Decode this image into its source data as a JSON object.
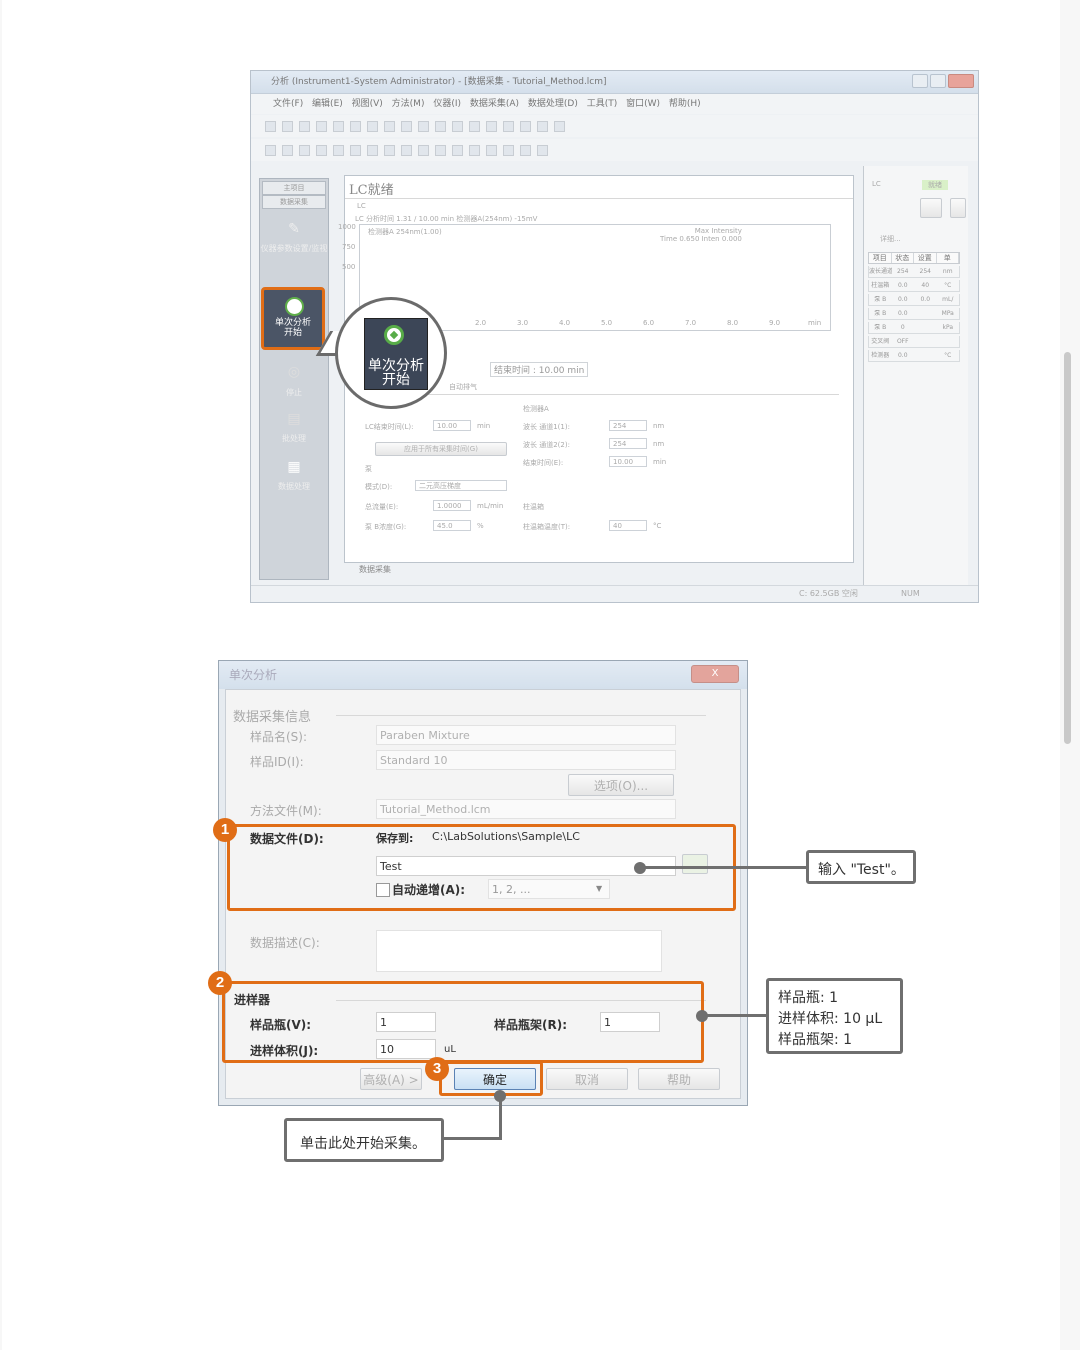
{
  "screenshot1": {
    "window_title": "分析 (Instrument1-System Administrator) - [数据采集 - Tutorial_Method.lcm]",
    "menu": "文件(F)  编辑(E)  视图(V)  方法(M)  仪器(I)  数据采集(A)  数据处理(D)  工具(T)  窗口(W)  帮助(H)",
    "left_panel": {
      "header": "主项目",
      "tab": "数据采集",
      "item_settings": "仪器参数设置/监视",
      "highlight_button": "单次分析\n开始",
      "item_stop": "停止",
      "item_batch": "批处理",
      "item_dataproc": "数据处理"
    },
    "zoom_label": "单次分析\n开始",
    "main": {
      "title_prefix": "LC",
      "title_suffix": "就绪",
      "lc_tab": "LC",
      "info_line": "LC 分析时间  1.31 / 10.00 min  检测器A(254nm)  -15mV",
      "plot_legend": "检测器A 254nm(1.00)",
      "plot_header": "Max Intensity\nTime  0.650  Inten  0.000",
      "y_ticks": [
        "1000",
        "750",
        "500"
      ],
      "x_ticks": [
        "2.0",
        "3.0",
        "4.0",
        "5.0",
        "6.0",
        "7.0",
        "8.0",
        "9.0",
        "min"
      ],
      "end_time_label": "结束时间 : 10.00 min",
      "auto_purge": "自动排气",
      "params_left": [
        {
          "label": "LC结束时间(L):",
          "value": "10.00",
          "unit": "min"
        },
        {
          "label": "应用于所有采集时间(G)",
          "value": "",
          "unit": ""
        },
        {
          "label": "泵",
          "value": "",
          "unit": ""
        },
        {
          "label": "模式(D):",
          "value": "二元高压梯度",
          "unit": ""
        },
        {
          "label": "总流量(E):",
          "value": "1.0000",
          "unit": "mL/min"
        },
        {
          "label": "泵 B浓度(G):",
          "value": "45.0",
          "unit": "%"
        }
      ],
      "params_right": [
        {
          "label": "检测器A",
          "value": "",
          "unit": ""
        },
        {
          "label": "波长 通道1(1):",
          "value": "254",
          "unit": "nm"
        },
        {
          "label": "波长 通道2(2):",
          "value": "254",
          "unit": "nm"
        },
        {
          "label": "结束时间(E):",
          "value": "10.00",
          "unit": "min"
        },
        {
          "label": "柱温箱",
          "value": "",
          "unit": ""
        },
        {
          "label": "柱温箱温度(T):",
          "value": "40",
          "unit": "°C"
        }
      ],
      "bottom_tab": "数据采集"
    },
    "right_panel": {
      "lc": "LC",
      "status": "就绪",
      "detail_btn": "详细...",
      "table_headers": [
        "项目",
        "状态",
        "设置",
        "单"
      ],
      "table_rows": [
        [
          "波长通道",
          "254",
          "254",
          "nm"
        ],
        [
          "柱温箱",
          "0.0",
          "40",
          "°C"
        ],
        [
          "泵 B",
          "0.0",
          "0.0",
          "mL/"
        ],
        [
          "泵 B",
          "0.0",
          "",
          "MPa"
        ],
        [
          "泵 B",
          "0",
          "",
          "kPa"
        ],
        [
          "交叉阀",
          "OFF",
          "",
          ""
        ],
        [
          "检测器",
          "0.0",
          "",
          "°C"
        ]
      ]
    },
    "status_disk": "C: 62.5GB 空闲",
    "status_num": "NUM"
  },
  "dialog": {
    "title": "单次分析",
    "close": "X",
    "section_info": "数据采集信息",
    "sample_name_label": "样品名(S):",
    "sample_name_value": "Paraben Mixture",
    "sample_id_label": "样品ID(I):",
    "sample_id_value": "Standard 10",
    "options_button": "选项(O)...",
    "method_label": "方法文件(M):",
    "method_value": "Tutorial_Method.lcm",
    "data_file_label": "数据文件(D):",
    "save_to_label": "保存到:",
    "save_to_value": "C:\\LabSolutions\\Sample\\LC",
    "data_file_value": "Test",
    "auto_increment_label": "自动递增(A):",
    "auto_increment_value": "1, 2, ...",
    "data_desc_label": "数据描述(C):",
    "section_injector": "进样器",
    "vial_label": "样品瓶(V):",
    "vial_value": "1",
    "rack_label": "样品瓶架(R):",
    "rack_value": "1",
    "volume_label": "进样体积(J):",
    "volume_value": "10",
    "volume_unit": "uL",
    "btn_advanced": "高级(A) >",
    "btn_ok": "确定",
    "btn_cancel": "取消",
    "btn_help": "帮助"
  },
  "annotations": {
    "badge1": "1",
    "badge2": "2",
    "badge3": "3",
    "callout1": "输入 \"Test\"。",
    "callout2_lines": [
      "样品瓶: 1",
      "进样体积: 10 μL",
      "样品瓶架: 1"
    ],
    "callout3": "单击此处开始采集。"
  },
  "colors": {
    "highlight": "#e06d16",
    "callout_border": "#6f6f6f"
  }
}
